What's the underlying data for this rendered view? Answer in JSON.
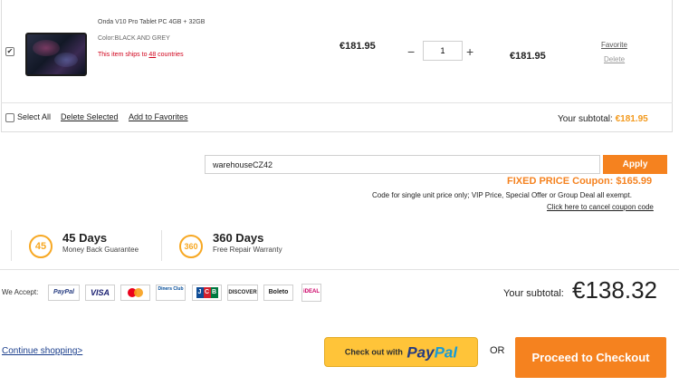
{
  "cart": {
    "item": {
      "checked": true,
      "name": "Onda V10 Pro Tablet PC 4GB + 32GB",
      "color_label": "Color:BLACK AND GREY",
      "ship_prefix": "This item ships to ",
      "ship_count": "48",
      "ship_suffix": " countries",
      "unit_price": "€181.95",
      "qty_minus": "−",
      "qty_value": "1",
      "qty_plus": "+",
      "line_total": "€181.95",
      "favorite_label": "Favorite",
      "delete_label": "Delete"
    },
    "select_all_label": "Select All",
    "delete_selected_label": "Delete Selected",
    "add_to_favorites_label": "Add to Favorites",
    "subtotal_label": "Your subtotal:",
    "subtotal_value": "€181.95"
  },
  "coupon": {
    "code": "warehouseCZ42",
    "apply_label": "Apply",
    "fixed_price_label": "FIXED PRICE Coupon: $165.99",
    "note": "Code for single unit price only; VIP Price, Special Offer or Group Deal all exempt.",
    "cancel_link": "Click here to cancel coupon code"
  },
  "guarantees": [
    {
      "badge": "45",
      "title": "45 Days",
      "subtitle": "Money Back Guarantee"
    },
    {
      "badge": "360",
      "title": "360 Days",
      "subtitle": "Free Repair Warranty"
    }
  ],
  "payment": {
    "we_accept_label": "We Accept:",
    "methods": [
      "PayPal",
      "VISA",
      "mastercard",
      "Diners Club",
      "JCB",
      "DISCOVER",
      "Boleto",
      "iDEAL"
    ]
  },
  "summary": {
    "subtotal_label": "Your subtotal:",
    "subtotal_value": "€138.32"
  },
  "actions": {
    "continue_label": "Continue shopping>",
    "paypal_prefix": "Check out with",
    "paypal_word1": "Pay",
    "paypal_word2": "Pal",
    "or_label": "OR",
    "checkout_label": "Proceed to Checkout"
  },
  "colors": {
    "accent_orange": "#f5821f",
    "badge_orange": "#f7a823",
    "paypal_yellow": "#ffc439",
    "ship_red": "#d0021b"
  }
}
